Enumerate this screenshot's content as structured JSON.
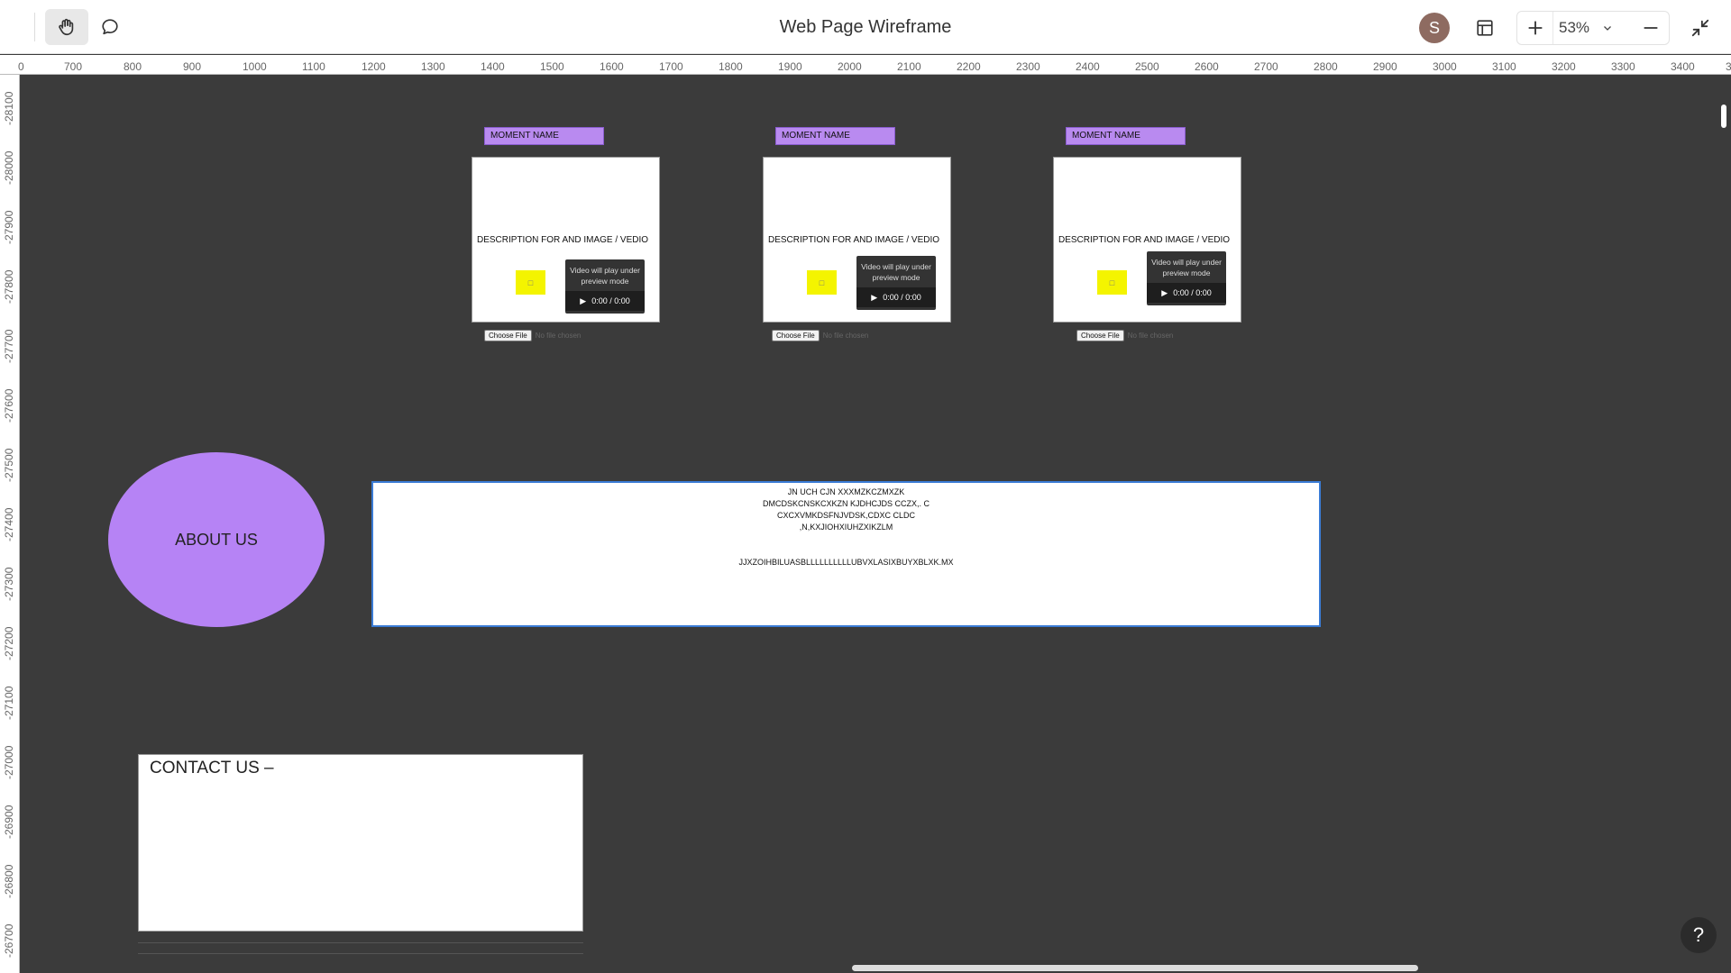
{
  "toolbar": {
    "title": "Web Page Wireframe",
    "avatar_initial": "S",
    "zoom_level": "53%",
    "icons": [
      "hand-icon",
      "comment-icon",
      "layout-icon",
      "plus-icon",
      "chevron-down-icon",
      "minus-icon",
      "collapse-icon"
    ]
  },
  "ruler": {
    "horizontal": [
      "0",
      "700",
      "800",
      "900",
      "1000",
      "1100",
      "1200",
      "1300",
      "1400",
      "1500",
      "1600",
      "1700",
      "1800",
      "1900",
      "2000",
      "2100",
      "2200",
      "2300",
      "2400",
      "2500",
      "2600",
      "2700",
      "2800",
      "2900",
      "3000",
      "3100",
      "3200",
      "3300",
      "3400",
      "3"
    ],
    "vertical": [
      "-28100",
      "-28000",
      "-27900",
      "-27800",
      "-27700",
      "-27600",
      "-27500",
      "-27400",
      "-27300",
      "-27200",
      "-27100",
      "-27000",
      "-26900",
      "-26800",
      "-26700"
    ]
  },
  "moments": [
    {
      "label": "MOMENT NAME",
      "description": "DESCRIPTION FOR AND IMAGE / VEDIO",
      "video_message": "Video will play under preview mode",
      "video_time": "0:00 / 0:00",
      "file_button": "Choose File",
      "file_status": "No file chosen"
    },
    {
      "label": "MOMENT NAME",
      "description": "DESCRIPTION FOR AND IMAGE / VEDIO",
      "video_message": "Video will play under preview mode",
      "video_time": "0:00 / 0:00",
      "file_button": "Choose File",
      "file_status": "No file chosen"
    },
    {
      "label": "MOMENT NAME",
      "description": "DESCRIPTION FOR AND IMAGE / VEDIO",
      "video_message": "Video will play under preview mode",
      "video_time": "0:00 / 0:00",
      "file_button": "Choose File",
      "file_status": "No file chosen"
    }
  ],
  "about": {
    "title": "ABOUT US",
    "lines": [
      "JN UCH CJN XXXMZKCZMXZK",
      "DMCDSKCNSKCXKZN KJDHCJDS CCZX,. C",
      "CXCXVMKDSFNJVDSK,CDXC CLDC",
      ",N,KXJIOHXIUHZXIKZLM"
    ],
    "footer_line": "JJXZOIHBILUASBLLLLLLLLLLUBVXLASIXBUYXBLXK.MX"
  },
  "contact": {
    "title": "CONTACT US –"
  },
  "help_label": "?"
}
